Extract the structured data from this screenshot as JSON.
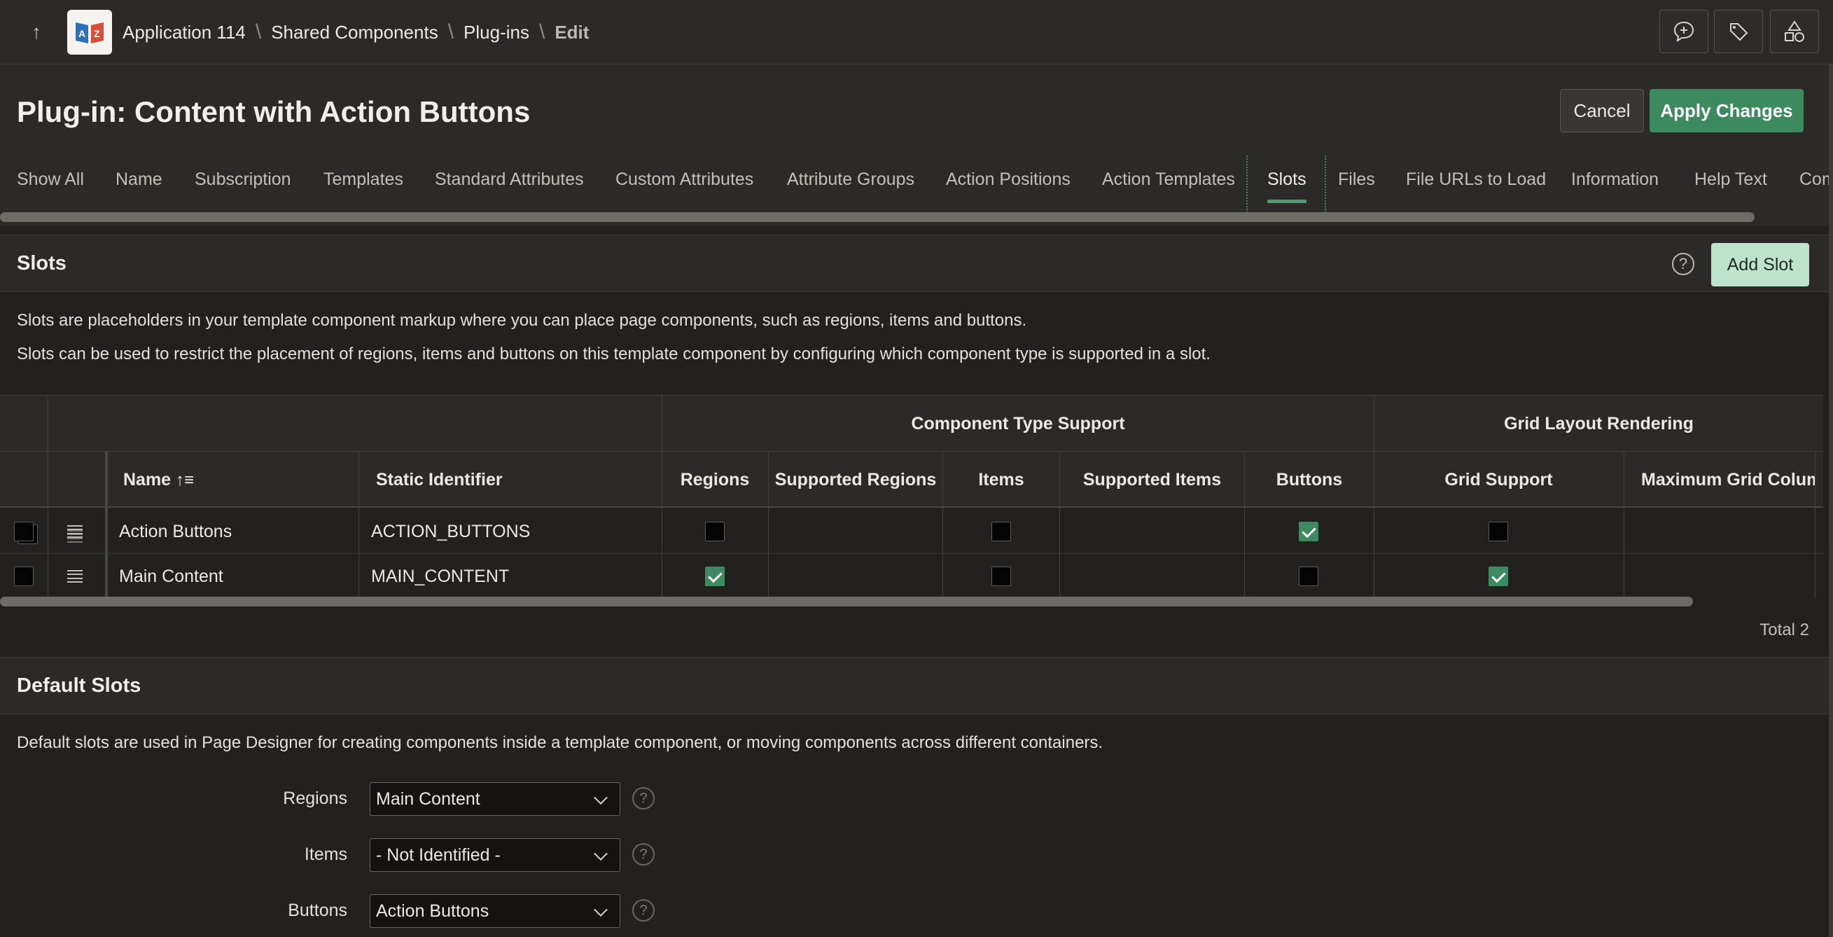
{
  "breadcrumb": {
    "app": "Application 114",
    "shared": "Shared Components",
    "plugins": "Plug-ins",
    "current": "Edit"
  },
  "icons": {
    "up": "arrow-up-icon",
    "logo": "app-logo-icon",
    "feedback": "chat-add-icon",
    "tag": "tag-icon",
    "shapes": "shapes-icon",
    "help": "help-icon"
  },
  "page": {
    "title": "Plug-in: Content with Action Buttons",
    "cancel": "Cancel",
    "apply": "Apply Changes"
  },
  "tabs": [
    "Show All",
    "Name",
    "Subscription",
    "Templates",
    "Standard Attributes",
    "Custom Attributes",
    "Attribute Groups",
    "Action Positions",
    "Action Templates",
    "Slots",
    "Files",
    "File URLs to Load",
    "Information",
    "Help Text",
    "Com"
  ],
  "active_tab": "Slots",
  "slots": {
    "title": "Slots",
    "add": "Add Slot",
    "desc1": "Slots are placeholders in your template component markup where you can place page components, such as regions, items and buttons.",
    "desc2": "Slots can be used to restrict the placement of regions, items and buttons on this template component by configuring which component type is supported in a slot.",
    "group_headers": {
      "component_type": "Component Type Support",
      "grid_layout": "Grid Layout Rendering"
    },
    "columns": {
      "name": "Name",
      "sort_icon": "↑≡",
      "static_id": "Static Identifier",
      "regions": "Regions",
      "supported_regions": "Supported Regions",
      "items": "Items",
      "supported_items": "Supported Items",
      "buttons": "Buttons",
      "grid_support": "Grid Support",
      "max_grid": "Maximum Grid Colum"
    },
    "rows": [
      {
        "name": "Action Buttons",
        "static_id": "ACTION_BUTTONS",
        "regions": false,
        "items": false,
        "buttons": true,
        "grid_support": false
      },
      {
        "name": "Main Content",
        "static_id": "MAIN_CONTENT",
        "regions": true,
        "items": false,
        "buttons": false,
        "grid_support": true
      }
    ],
    "total": "Total 2"
  },
  "default_slots": {
    "title": "Default Slots",
    "desc": "Default slots are used in Page Designer for creating components inside a template component, or moving components across different containers.",
    "fields": [
      {
        "label": "Regions",
        "value": "Main Content"
      },
      {
        "label": "Items",
        "value": "- Not Identified -"
      },
      {
        "label": "Buttons",
        "value": "Action Buttons"
      }
    ]
  },
  "colors": {
    "accent": "#3d8a5f",
    "add_button": "#bfe2cd",
    "background": "#222120",
    "panel": "#2c2a28"
  }
}
